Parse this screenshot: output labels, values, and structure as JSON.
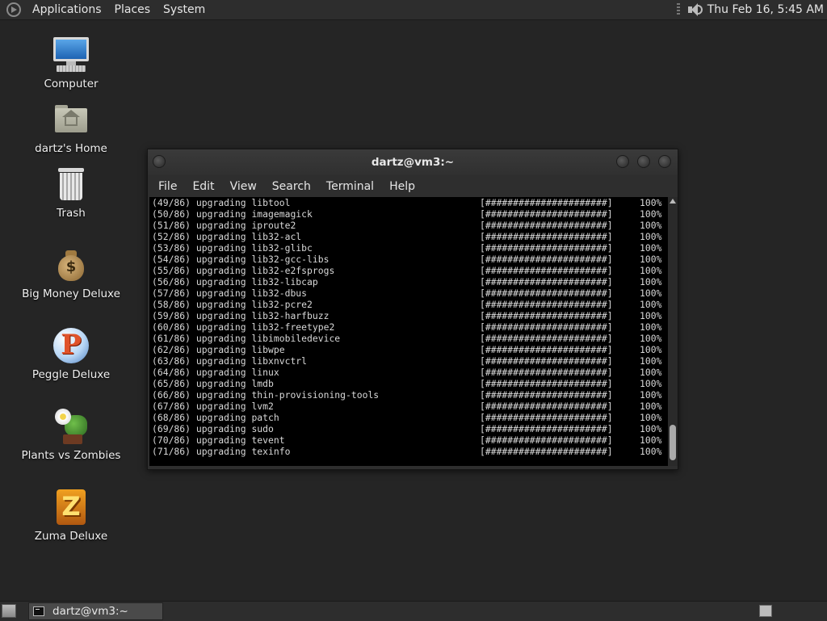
{
  "top_panel": {
    "menus": [
      "Applications",
      "Places",
      "System"
    ],
    "clock": "Thu Feb 16,  5:45 AM"
  },
  "desktop_icons": [
    {
      "label": "Computer",
      "icon": "computer-icon"
    },
    {
      "label": "dartz's Home",
      "icon": "home-folder-icon"
    },
    {
      "label": "Trash",
      "icon": "trash-icon"
    },
    {
      "label": "Big Money Deluxe",
      "icon": "money-bag-icon"
    },
    {
      "label": "Peggle Deluxe",
      "icon": "peggle-icon"
    },
    {
      "label": "Plants vs Zombies",
      "icon": "plants-icon"
    },
    {
      "label": "Zuma Deluxe",
      "icon": "zuma-icon"
    }
  ],
  "terminal": {
    "title": "dartz@vm3:~",
    "menu": [
      "File",
      "Edit",
      "View",
      "Search",
      "Terminal",
      "Help"
    ],
    "lines": [
      {
        "text": "(49/86) upgrading libtool",
        "bar": "[######################]",
        "pct": "100%"
      },
      {
        "text": "(50/86) upgrading imagemagick",
        "bar": "[######################]",
        "pct": "100%"
      },
      {
        "text": "(51/86) upgrading iproute2",
        "bar": "[######################]",
        "pct": "100%"
      },
      {
        "text": "(52/86) upgrading lib32-acl",
        "bar": "[######################]",
        "pct": "100%"
      },
      {
        "text": "(53/86) upgrading lib32-glibc",
        "bar": "[######################]",
        "pct": "100%"
      },
      {
        "text": "(54/86) upgrading lib32-gcc-libs",
        "bar": "[######################]",
        "pct": "100%"
      },
      {
        "text": "(55/86) upgrading lib32-e2fsprogs",
        "bar": "[######################]",
        "pct": "100%"
      },
      {
        "text": "(56/86) upgrading lib32-libcap",
        "bar": "[######################]",
        "pct": "100%"
      },
      {
        "text": "(57/86) upgrading lib32-dbus",
        "bar": "[######################]",
        "pct": "100%"
      },
      {
        "text": "(58/86) upgrading lib32-pcre2",
        "bar": "[######################]",
        "pct": "100%"
      },
      {
        "text": "(59/86) upgrading lib32-harfbuzz",
        "bar": "[######################]",
        "pct": "100%"
      },
      {
        "text": "(60/86) upgrading lib32-freetype2",
        "bar": "[######################]",
        "pct": "100%"
      },
      {
        "text": "(61/86) upgrading libimobiledevice",
        "bar": "[######################]",
        "pct": "100%"
      },
      {
        "text": "(62/86) upgrading libwpe",
        "bar": "[######################]",
        "pct": "100%"
      },
      {
        "text": "(63/86) upgrading libxnvctrl",
        "bar": "[######################]",
        "pct": "100%"
      },
      {
        "text": "(64/86) upgrading linux",
        "bar": "[######################]",
        "pct": "100%"
      },
      {
        "text": "(65/86) upgrading lmdb",
        "bar": "[######################]",
        "pct": "100%"
      },
      {
        "text": "(66/86) upgrading thin-provisioning-tools",
        "bar": "[######################]",
        "pct": "100%"
      },
      {
        "text": "(67/86) upgrading lvm2",
        "bar": "[######################]",
        "pct": "100%"
      },
      {
        "text": "(68/86) upgrading patch",
        "bar": "[######################]",
        "pct": "100%"
      },
      {
        "text": "(69/86) upgrading sudo",
        "bar": "[######################]",
        "pct": "100%"
      },
      {
        "text": "(70/86) upgrading tevent",
        "bar": "[######################]",
        "pct": "100%"
      },
      {
        "text": "(71/86) upgrading texinfo",
        "bar": "[######################]",
        "pct": "100%"
      }
    ]
  },
  "taskbar": {
    "tasks": [
      {
        "label": "dartz@vm3:~",
        "icon": "terminal-icon"
      }
    ]
  }
}
